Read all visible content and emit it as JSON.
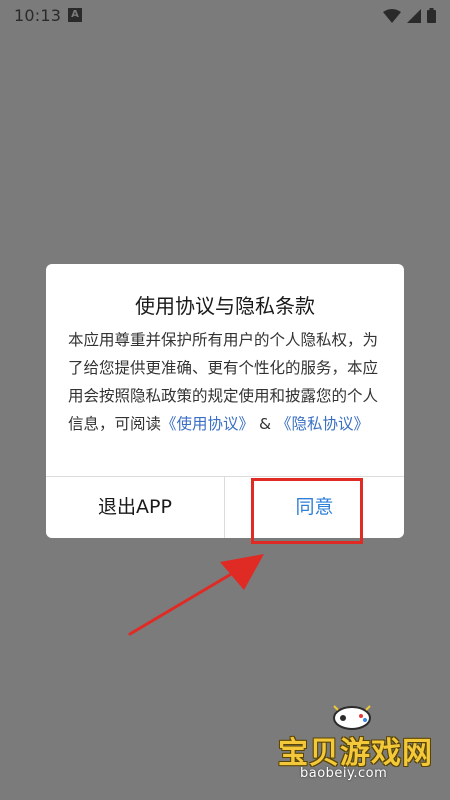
{
  "status_bar": {
    "time": "10:13",
    "notification_icon": "A"
  },
  "dialog": {
    "title": "使用协议与隐私条款",
    "body_text": "本应用尊重并保护所有用户的个人隐私权，为了给您提供更准确、更有个性化的服务，本应用会按照隐私政策的规定使用和披露您的个人信息，可阅读",
    "link_terms": "《使用协议》",
    "separator": " & ",
    "link_privacy": "《隐私协议》",
    "exit_label": "退出APP",
    "agree_label": "同意"
  },
  "watermark": {
    "text": "宝贝游戏网",
    "url": "baobeiy.com"
  },
  "colors": {
    "overlay": "#7b7b7b",
    "link": "#3a6fc4",
    "agree": "#2f7fd8",
    "highlight": "#e02a24"
  }
}
